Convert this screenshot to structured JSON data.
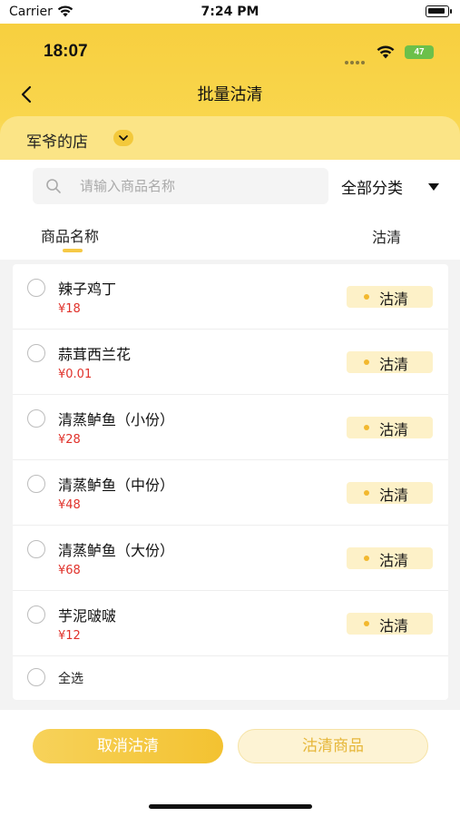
{
  "system_bar": {
    "carrier": "Carrier",
    "time": "7:24 PM"
  },
  "device_status": {
    "time": "18:07",
    "battery": "47"
  },
  "header": {
    "title": "批量沽清"
  },
  "store": {
    "name": "军爷的店"
  },
  "search": {
    "placeholder": "请输入商品名称",
    "category": "全部分类"
  },
  "columns": {
    "name": "商品名称",
    "clear": "沽清"
  },
  "items": [
    {
      "name": "辣子鸡丁",
      "price": "¥18",
      "action": "沽清"
    },
    {
      "name": "蒜茸西兰花",
      "price": "¥0.01",
      "action": "沽清"
    },
    {
      "name": "清蒸鲈鱼（小份）",
      "price": "¥28",
      "action": "沽清"
    },
    {
      "name": "清蒸鲈鱼（中份）",
      "price": "¥48",
      "action": "沽清"
    },
    {
      "name": "清蒸鲈鱼（大份）",
      "price": "¥68",
      "action": "沽清"
    },
    {
      "name": "芋泥啵啵",
      "price": "¥12",
      "action": "沽清"
    }
  ],
  "select_all": {
    "label": "全选"
  },
  "footer": {
    "cancel_label": "取消沽清",
    "clear_label": "沽清商品"
  },
  "colors": {
    "accent": "#f6c945",
    "price": "#e0322b",
    "tag_bg": "#fdf1c8"
  },
  "icons": {
    "back": "chevron-left-icon",
    "dropdown": "chevron-down-icon",
    "search": "search-icon",
    "wifi": "wifi-icon"
  }
}
